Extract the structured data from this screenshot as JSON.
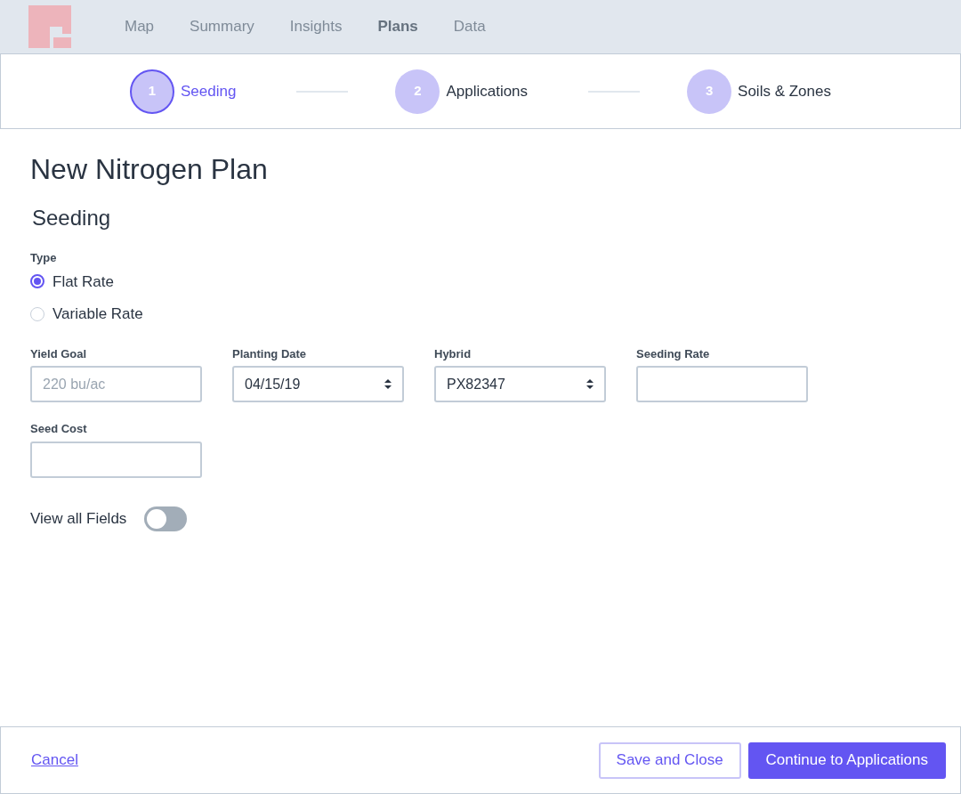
{
  "nav": {
    "items": [
      {
        "label": "Map",
        "selected": false
      },
      {
        "label": "Summary",
        "selected": false
      },
      {
        "label": "Insights",
        "selected": false
      },
      {
        "label": "Plans",
        "selected": true
      },
      {
        "label": "Data",
        "selected": false
      }
    ]
  },
  "stepper": {
    "steps": [
      {
        "number": "1",
        "label": "Seeding",
        "selected": true
      },
      {
        "number": "2",
        "label": "Applications",
        "selected": false
      },
      {
        "number": "3",
        "label": "Soils & Zones",
        "selected": false
      }
    ]
  },
  "page_title": "New Nitrogen Plan",
  "section_title": "Seeding",
  "type": {
    "label": "Type",
    "options": [
      {
        "label": "Flat Rate",
        "selected": true
      },
      {
        "label": "Variable Rate",
        "selected": false
      }
    ]
  },
  "fields": [
    {
      "label": "Yield Goal",
      "kind": "input",
      "placeholder": "220 bu/ac"
    },
    {
      "label": "Planting Date",
      "kind": "select",
      "value": "04/15/19"
    },
    {
      "label": "Hybrid",
      "kind": "select",
      "value": "PX82347"
    },
    {
      "label": "Seeding Rate",
      "kind": "input"
    },
    {
      "label": "Seed Cost",
      "kind": "input"
    }
  ],
  "toggle": {
    "label": "View all Fields",
    "on": false
  },
  "footer": {
    "cancel": "Cancel",
    "buttons": [
      {
        "label": "Save and Close",
        "kind": "secondary"
      },
      {
        "label": "Continue to Applications",
        "kind": "primary"
      }
    ]
  }
}
